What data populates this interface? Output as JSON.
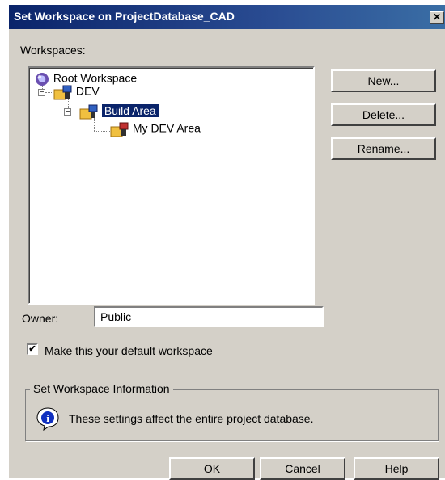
{
  "window": {
    "title": "Set Workspace on ProjectDatabase_CAD",
    "close_label": "✕"
  },
  "workspaces_label": "Workspaces:",
  "tree": {
    "items": [
      {
        "label": "Root Workspace",
        "icon": "globe-icon"
      },
      {
        "label": "DEV",
        "icon": "workspace-folder-icon",
        "expander": "−"
      },
      {
        "label": "Build Area",
        "icon": "workspace-folder-icon",
        "expander": "−",
        "selected": true
      },
      {
        "label": "My DEV Area",
        "icon": "workspace-folder-icon"
      }
    ]
  },
  "buttons": {
    "new": "New...",
    "delete": "Delete...",
    "rename": "Rename...",
    "ok": "OK",
    "cancel": "Cancel",
    "help": "Help"
  },
  "owner": {
    "label": "Owner:",
    "value": "Public"
  },
  "default_checkbox": {
    "label": "Make this your default workspace",
    "checked": true,
    "mark": "✔"
  },
  "info_group": {
    "title": "Set Workspace Information",
    "message": "These settings affect the entire project database.",
    "icon": "info-icon"
  },
  "colors": {
    "title_bar": "#0a246a",
    "selection": "#0a246a",
    "face": "#d4d0c8"
  }
}
